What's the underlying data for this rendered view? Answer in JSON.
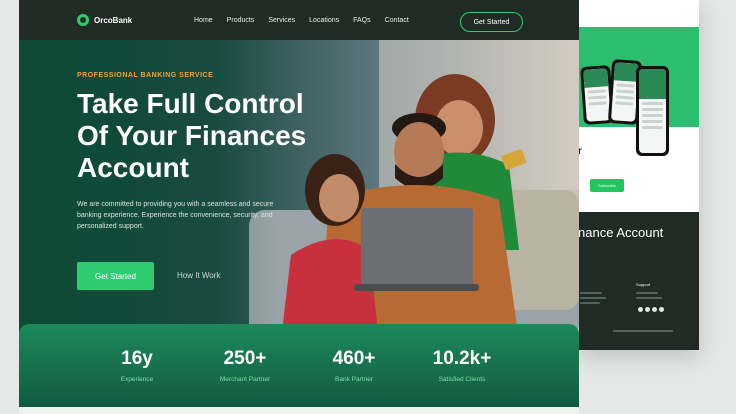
{
  "brand": {
    "name": "OrcoBank"
  },
  "nav": {
    "items": [
      "Home",
      "Products",
      "Services",
      "Locations",
      "FAQs",
      "Contact"
    ],
    "cta": "Get Started"
  },
  "hero": {
    "eyebrow": "PROFESSIONAL BANKING SERVICE",
    "title": "Take Full Control Of Your Finances Account",
    "description": "We are committed to providing you with a seamless and secure banking experience. Experience the convenience, security, and personalized support.",
    "primary_cta": "Get Started",
    "secondary_cta": "How It Work"
  },
  "stats": [
    {
      "value": "16y",
      "label": "Experience"
    },
    {
      "value": "250+",
      "label": "Merchant Partner"
    },
    {
      "value": "460+",
      "label": "Bank Partner"
    },
    {
      "value": "10.2k+",
      "label": "Satisfied Clients"
    }
  ],
  "mockup": {
    "text_fragment": "r",
    "subscribe": "Subscribe",
    "footer_title": "nance Account",
    "footer_support": "Support"
  },
  "colors": {
    "accent": "#2ecc71",
    "dark": "#1f2b24",
    "eyebrow": "#f0a23b"
  }
}
